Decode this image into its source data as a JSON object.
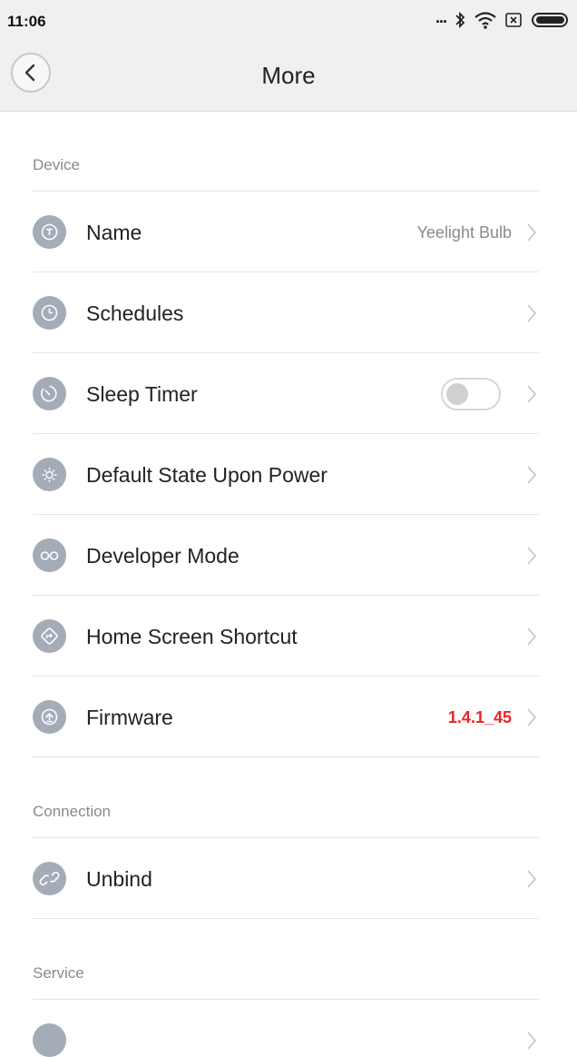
{
  "status_bar": {
    "time": "11:06",
    "icons": [
      "more-dots-icon",
      "bluetooth-icon",
      "wifi-icon",
      "no-sim-icon",
      "battery-icon"
    ],
    "dots": "..."
  },
  "header": {
    "title": "More",
    "back_icon": "chevron-left-icon"
  },
  "sections": {
    "device": {
      "title": "Device",
      "items": [
        {
          "label": "Name",
          "value": "Yeelight Bulb",
          "icon": "name-icon"
        },
        {
          "label": "Schedules",
          "icon": "clock-icon"
        },
        {
          "label": "Sleep Timer",
          "icon": "timer-icon",
          "toggle": false
        },
        {
          "label": "Default State Upon Power",
          "icon": "power-state-icon"
        },
        {
          "label": "Developer Mode",
          "icon": "glasses-icon"
        },
        {
          "label": "Home Screen Shortcut",
          "icon": "shortcut-icon"
        },
        {
          "label": "Firmware",
          "value": "1.4.1_45",
          "value_color": "#ee2222",
          "icon": "firmware-upgrade-icon"
        }
      ]
    },
    "connection": {
      "title": "Connection",
      "items": [
        {
          "label": "Unbind",
          "icon": "link-icon"
        }
      ]
    },
    "service": {
      "title": "Service"
    }
  },
  "colors": {
    "header_bg": "#f0f0f0",
    "icon_bg": "#a4acb8",
    "divider": "#e6e6e6",
    "accent_red": "#ee2222"
  }
}
